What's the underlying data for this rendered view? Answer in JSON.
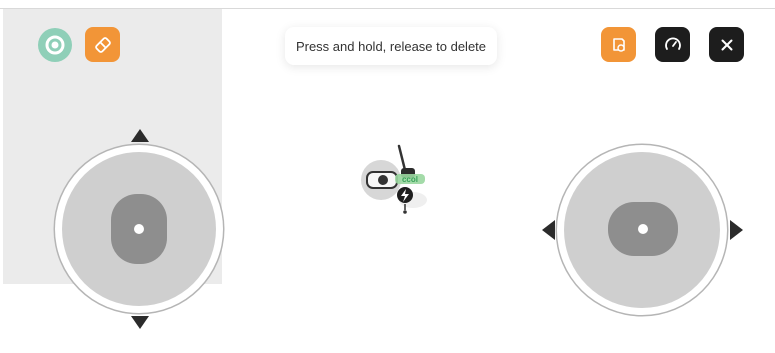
{
  "toolbar_left": {
    "buttons": [
      {
        "name": "mode-toggle-button",
        "icon": "target-ring-icon",
        "color": "#8fcfb8"
      },
      {
        "name": "eraser-button",
        "icon": "eraser-icon",
        "color": "#f29537"
      }
    ]
  },
  "toast": {
    "message": "Press and hold, release to delete"
  },
  "toolbar_right": {
    "buttons": [
      {
        "name": "map-edit-button",
        "icon": "map-erase-icon",
        "color": "#f29537"
      },
      {
        "name": "speed-button",
        "icon": "speedometer-icon",
        "color": "#1d1d1d"
      },
      {
        "name": "close-button",
        "icon": "close-icon",
        "color": "#1d1d1d"
      }
    ]
  },
  "joysticks": {
    "left": {
      "axis": "vertical",
      "icon": "up-down-arrows"
    },
    "right": {
      "axis": "horizontal",
      "icon": "left-right-arrows"
    }
  },
  "robot": {
    "icon": "lawn-mower-robot-icon",
    "charging_icon": "lightning-icon"
  }
}
